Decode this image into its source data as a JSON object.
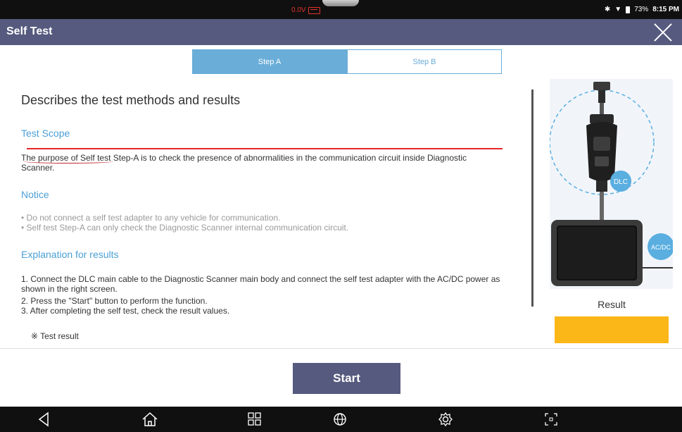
{
  "status_bar": {
    "voltage": "0.0V",
    "battery_percent": "73%",
    "time": "8:15 PM"
  },
  "header": {
    "title": "Self Test"
  },
  "tabs": [
    {
      "label": "Step A",
      "active": true
    },
    {
      "label": "Step B",
      "active": false
    }
  ],
  "content": {
    "heading": "Describes the test methods and results",
    "test_scope_title": "Test Scope",
    "test_scope_text": "The purpose of Self test Step-A is to check the presence of abnormalities in the communication circuit inside Diagnostic Scanner.",
    "notice_title": "Notice",
    "notice_items": [
      "• Do not connect a self test adapter to any vehicle for communication.",
      "• Self test Step-A can only check the Diagnostic Scanner internal communication circuit."
    ],
    "results_title": "Explanation for results",
    "steps": [
      "1. Connect the DLC main cable to the Diagnostic Scanner main body and connect the self test adapter with the AC/DC power as shown in the right screen.",
      "2. Press the \"Start\" button to perform the function.",
      "3. After completing the self test, check the result values."
    ],
    "test_result_label": "※ Test result"
  },
  "right_panel": {
    "dlc_label": "DLC",
    "acdc_label": "AC/DC",
    "result_label": "Result",
    "result_color": "#fbb617"
  },
  "actions": {
    "start_label": "Start"
  },
  "nav_bar": {
    "icons": [
      "back-icon",
      "home-icon",
      "apps-icon",
      "globe-icon",
      "settings-icon",
      "screenshot-icon"
    ]
  },
  "colors": {
    "header_bg": "#555a7e",
    "accent_blue": "#4a9fd6",
    "tab_active": "#6aadd8",
    "annotation_red": "#e8242a"
  }
}
